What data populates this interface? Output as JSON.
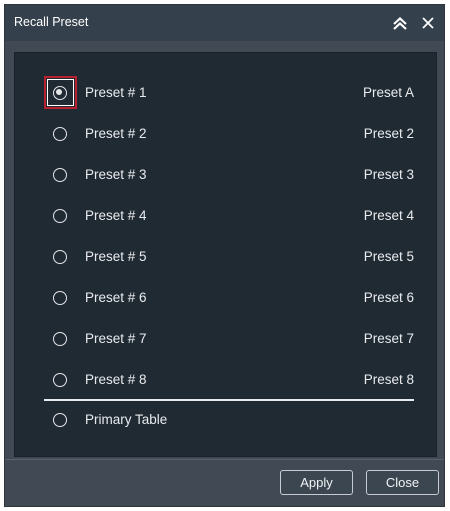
{
  "window": {
    "title": "Recall Preset",
    "collapse_icon": "double-chevron-up",
    "close_icon": "close-x"
  },
  "presets": [
    {
      "label": "Preset # 1",
      "value": "Preset A",
      "selected": true
    },
    {
      "label": "Preset # 2",
      "value": "Preset 2",
      "selected": false
    },
    {
      "label": "Preset # 3",
      "value": "Preset 3",
      "selected": false
    },
    {
      "label": "Preset # 4",
      "value": "Preset 4",
      "selected": false
    },
    {
      "label": "Preset # 5",
      "value": "Preset 5",
      "selected": false
    },
    {
      "label": "Preset # 6",
      "value": "Preset 6",
      "selected": false
    },
    {
      "label": "Preset # 7",
      "value": "Preset 7",
      "selected": false
    },
    {
      "label": "Preset # 8",
      "value": "Preset 8",
      "selected": false
    }
  ],
  "primary_table": {
    "label": "Primary Table",
    "selected": false
  },
  "buttons": {
    "apply_label": "Apply",
    "close_label": "Close"
  },
  "colors": {
    "dialog_bg": "#404954",
    "titlebar_bg": "#34404b",
    "panel_bg": "#202a33",
    "focus_ring": "#b7202e",
    "text": "#e9ecef"
  }
}
